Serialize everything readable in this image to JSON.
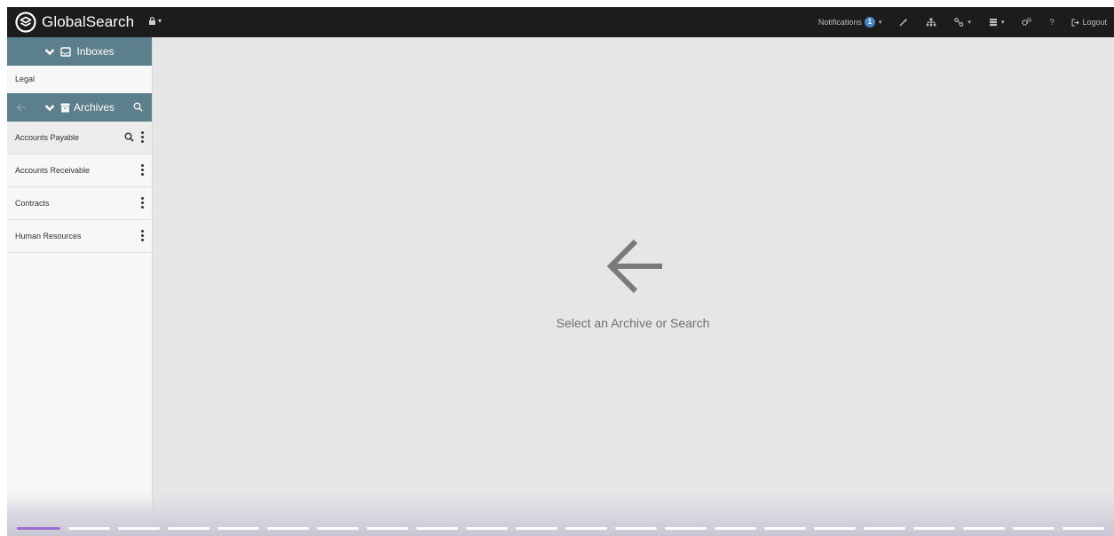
{
  "app": {
    "name": "GlobalSearch"
  },
  "navbar": {
    "notifications_label": "Notifications",
    "notifications_count": "1",
    "logout_label": "Logout",
    "help_label": "?"
  },
  "sidebar": {
    "inboxes": {
      "title": "Inboxes",
      "items": [
        {
          "label": "Legal"
        }
      ]
    },
    "archives": {
      "title": "Archives",
      "items": [
        {
          "label": "Accounts Payable",
          "selected": true
        },
        {
          "label": "Accounts Receivable"
        },
        {
          "label": "Contracts"
        },
        {
          "label": "Human Resources"
        }
      ]
    }
  },
  "main": {
    "message": "Select an Archive or Search"
  },
  "colors": {
    "navbar": "#1c1c1c",
    "panel_header": "#5b7f8b",
    "badge": "#4a86c5",
    "progress_active": "#9b6fd1"
  },
  "pager": {
    "total": 22,
    "active_index": 0
  }
}
